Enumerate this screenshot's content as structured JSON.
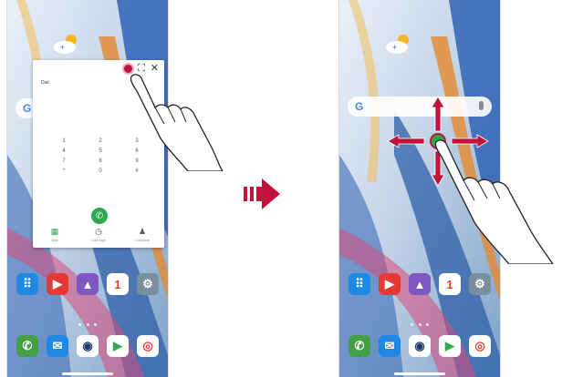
{
  "left_screen": {
    "popup": {
      "title": "Dial",
      "controls": [
        "●",
        "⛶",
        "✕"
      ],
      "keypad": [
        "1",
        "2",
        "3",
        "4",
        "5",
        "6",
        "7",
        "8",
        "9",
        "*",
        "0",
        "#"
      ],
      "tabs": [
        {
          "icon": "▦",
          "label": "Dial"
        },
        {
          "icon": "◷",
          "label": "Call logs"
        },
        {
          "icon": "♟",
          "label": "Contacts"
        }
      ]
    }
  },
  "right_screen": {
    "search_bar": {
      "logo": "G"
    }
  },
  "apps_row": [
    {
      "icon": "⠿",
      "color": "#1e88e5"
    },
    {
      "icon": "▶",
      "color": "#e53935"
    },
    {
      "icon": "▲",
      "color": "#7e57c2"
    },
    {
      "icon": "1",
      "color": "#ffffff"
    },
    {
      "icon": "⚙",
      "color": "#78909c"
    }
  ],
  "dock_row": [
    {
      "icon": "✆",
      "color": "#43a047"
    },
    {
      "icon": "✉",
      "color": "#1e88e5"
    },
    {
      "icon": "◉",
      "color": "#ffffff"
    },
    {
      "icon": "▶",
      "color": "#ffffff"
    },
    {
      "icon": "◎",
      "color": "#ffffff"
    }
  ],
  "icons": {
    "transition": "arrow-right-icon",
    "gesture": "hand-pointer-icon",
    "drag": "four-way-arrow-icon"
  },
  "colors": {
    "accent": "#c0143c",
    "call_green": "#2ea84d"
  }
}
